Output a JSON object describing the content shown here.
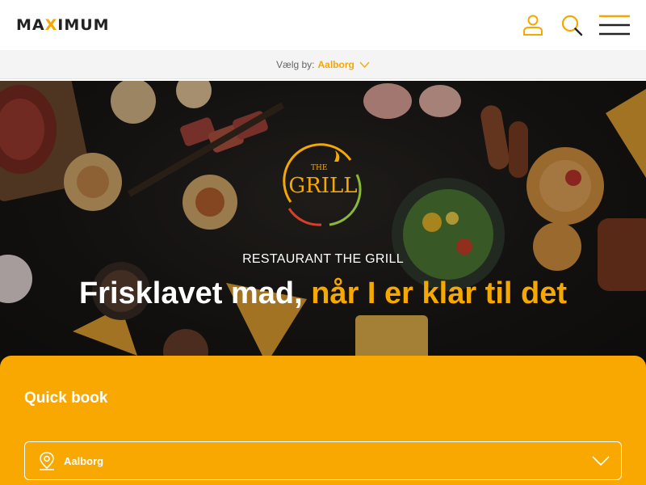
{
  "header": {
    "logo_prefix": "MA",
    "logo_accent": "X",
    "logo_suffix": "IMUM"
  },
  "citybar": {
    "label": "Vælg by:",
    "city": "Aalborg"
  },
  "hero": {
    "logo_small": "THE",
    "logo_main": "GRILL",
    "subtitle": "RESTAURANT THE GRILL",
    "headline_white": "Frisklavet mad,",
    "headline_accent": "når I er klar til det"
  },
  "quickbook": {
    "title": "Quick book",
    "location_value": "Aalborg"
  },
  "colors": {
    "accent": "#f5a800",
    "panel": "#f8a800",
    "hero_dark": "#1a1816"
  },
  "icons": [
    "user-icon",
    "search-icon",
    "menu-icon",
    "chevron-down-icon",
    "location-pin-icon"
  ]
}
